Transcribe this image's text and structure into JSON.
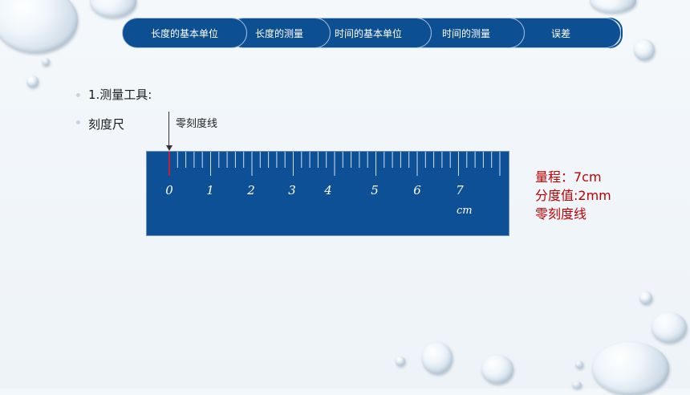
{
  "nav": {
    "tabs": [
      {
        "label": "长度的基本单位"
      },
      {
        "label": "长度的测量"
      },
      {
        "label": "时间的基本单位"
      },
      {
        "label": "时间的测量"
      },
      {
        "label": "误差"
      }
    ]
  },
  "content": {
    "heading": "1.测量工具:",
    "tool": "刻度尺",
    "zero_mark_label": "零刻度线"
  },
  "ruler": {
    "numbers": [
      "0",
      "1",
      "2",
      "3",
      "4",
      "5",
      "6",
      "7"
    ],
    "unit": "cm"
  },
  "info": {
    "range": "量程：7cm",
    "division": "分度值:2mm",
    "zero_line": "零刻度线"
  },
  "colors": {
    "tab_fill": "#0d4f93",
    "ruler_fill": "#0e5096",
    "highlight_red": "#c00000"
  }
}
